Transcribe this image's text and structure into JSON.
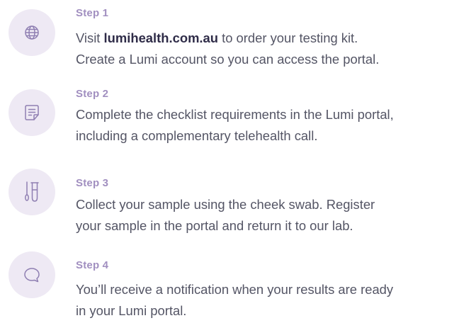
{
  "steps": [
    {
      "title": "Step 1",
      "icon": "globe-icon",
      "line1_prefix": "Visit ",
      "link": "lumihealth.com.au",
      "line1_suffix": " to order your testing kit.",
      "line2": "Create a Lumi account so you can access the portal."
    },
    {
      "title": "Step 2",
      "icon": "document-checklist-icon",
      "line1": "Complete the checklist requirements in the Lumi portal,",
      "line2": "including a complementary telehealth call."
    },
    {
      "title": "Step 3",
      "icon": "test-tube-swab-icon",
      "line1": "Collect your sample using the cheek swab. Register",
      "line2": "your sample in the portal and return it to our lab."
    },
    {
      "title": "Step 4",
      "icon": "chat-bubble-icon",
      "line1": "You’ll receive a notification when your results are ready",
      "line2": "in your Lumi portal."
    }
  ],
  "colors": {
    "accent": "#a18fc0",
    "icon_bg": "#eee9f4",
    "icon_stroke": "#8f7fb2",
    "body_text": "#545565",
    "link_text": "#2f2c48"
  }
}
